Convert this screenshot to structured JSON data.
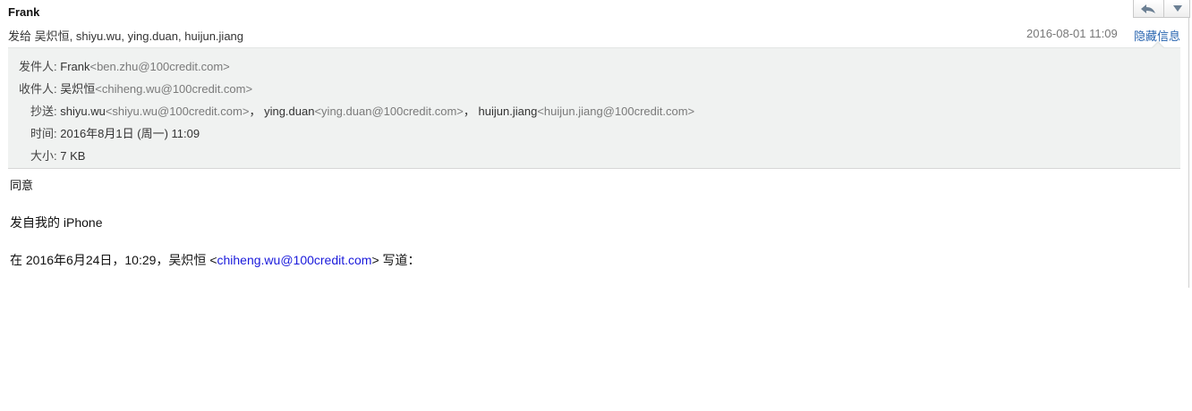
{
  "header": {
    "sender": "Frank",
    "to_line": "发给 吴炽恒, shiyu.wu, ying.duan, huijun.jiang",
    "date": "2016-08-01 11:09",
    "hide_details": "隐藏信息"
  },
  "toolbar": {
    "reply_icon": "reply-arrow-icon",
    "more_icon": "chevron-down-icon"
  },
  "details": {
    "from_label": "发件人:",
    "from_name": "Frank",
    "from_addr": "<ben.zhu@100credit.com>",
    "to_label": "收件人:",
    "to_name": "吴炽恒",
    "to_addr": "<chiheng.wu@100credit.com>",
    "cc_label": "抄送:",
    "cc": [
      {
        "name": "shiyu.wu",
        "addr": "<shiyu.wu@100credit.com>",
        "sep": "，"
      },
      {
        "name": "ying.duan",
        "addr": "<ying.duan@100credit.com>",
        "sep": "，"
      },
      {
        "name": "huijun.jiang",
        "addr": "<huijun.jiang@100credit.com>",
        "sep": ""
      }
    ],
    "time_label": "时间:",
    "time_value": "2016年8月1日 (周一) 11:09",
    "size_label": "大小:",
    "size_value": "7 KB"
  },
  "body": {
    "line1": "同意",
    "line2": "发自我的 iPhone",
    "quote_prefix": "在 2016年6月24日，10:29，吴炽恒 <",
    "quote_link": "chiheng.wu@100credit.com",
    "quote_suffix": "> 写道："
  }
}
